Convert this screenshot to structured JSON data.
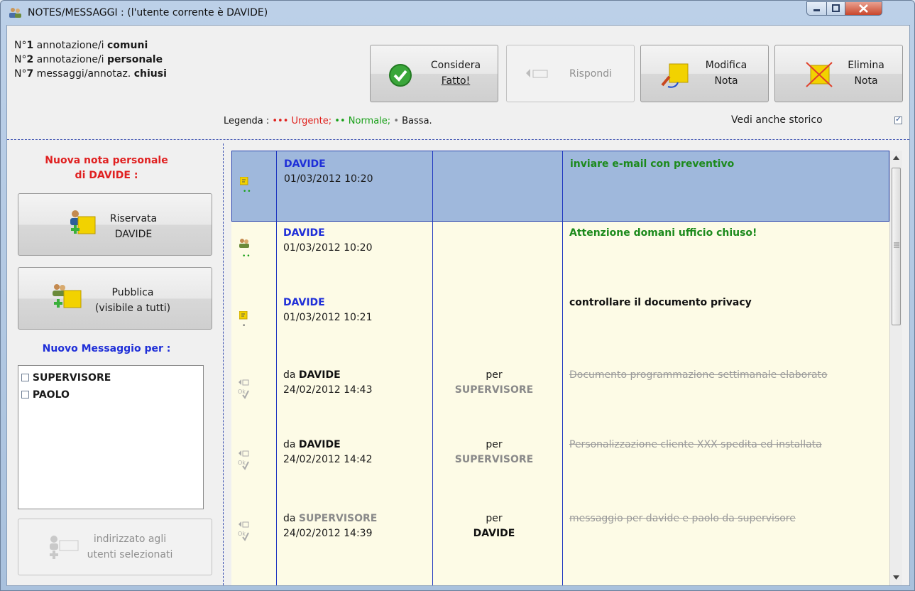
{
  "window": {
    "title": "NOTES/MESSAGGI : (l'utente corrente è DAVIDE)"
  },
  "stats": [
    {
      "prefix": "N°",
      "num": "1",
      "text": " annotazione/i ",
      "bold": "comuni"
    },
    {
      "prefix": "N°",
      "num": "2",
      "text": " annotazione/i ",
      "bold": "personale"
    },
    {
      "prefix": "N°",
      "num": "7",
      "text": " messaggi/annotaz. ",
      "bold": "chiusi"
    }
  ],
  "toolbar": {
    "done_line1": "Considera",
    "done_line2": "Fatto!",
    "reply": "Rispondi",
    "edit_line1": "Modifica",
    "edit_line2": "Nota",
    "delete_line1": "Elimina",
    "delete_line2": "Nota"
  },
  "legend": {
    "label": "Legenda :",
    "urgent_dots": "•••",
    "urgent": "Urgente;",
    "normal_dots": "••",
    "normal": "Normale;",
    "low_dots": "•",
    "low": "Bassa."
  },
  "history": {
    "label": "Vedi anche storico",
    "checked": true
  },
  "left": {
    "new_note_line1": "Nuova nota personale",
    "new_note_line2": "di DAVIDE :",
    "private_line1": "Riservata",
    "private_line2": "DAVIDE",
    "public_line1": "Pubblica",
    "public_line2": "(visibile a tutti)",
    "new_message": "Nuovo Messaggio per :",
    "users": [
      "SUPERVISORE",
      "PAOLO"
    ],
    "send_line1": "indirizzato agli",
    "send_line2": "utenti selezionati"
  },
  "rows": [
    {
      "from_prefix": "",
      "from": "DAVIDE",
      "date": "01/03/2012 10:20",
      "to_prefix": "",
      "to": "",
      "text": "inviare e-mail con preventivo",
      "dots": "••"
    },
    {
      "from_prefix": "",
      "from": "DAVIDE",
      "date": "01/03/2012 10:20",
      "to_prefix": "",
      "to": "",
      "text": "Attenzione domani ufficio chiuso!",
      "dots": "••"
    },
    {
      "from_prefix": "",
      "from": "DAVIDE",
      "date": "01/03/2012 10:21",
      "to_prefix": "",
      "to": "",
      "text": "controllare il documento privacy",
      "dots": "•"
    },
    {
      "from_prefix": "da ",
      "from": "DAVIDE",
      "date": "24/02/2012 14:43",
      "to_prefix": "per",
      "to": "SUPERVISORE",
      "text": "Documento programmazione settimanale elaborato",
      "dots": ""
    },
    {
      "from_prefix": "da ",
      "from": "DAVIDE",
      "date": "24/02/2012 14:42",
      "to_prefix": "per",
      "to": "SUPERVISORE",
      "text": "Personalizzazione cliente XXX spedita ed installata",
      "dots": ""
    },
    {
      "from_prefix": "da ",
      "from": "SUPERVISORE",
      "date": "24/02/2012 14:39",
      "to_prefix": "per",
      "to": "DAVIDE",
      "text": "messaggio per davide e paolo da supervisore",
      "dots": ""
    }
  ]
}
